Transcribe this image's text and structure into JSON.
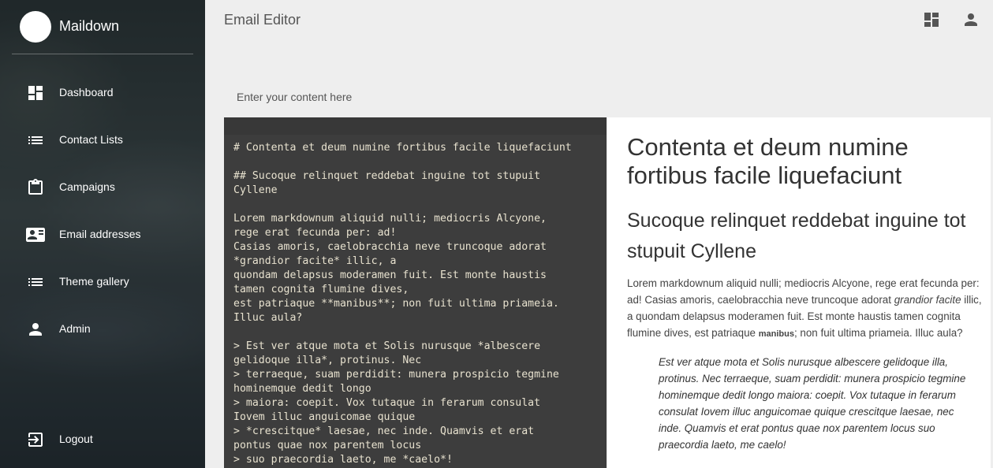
{
  "sidebar": {
    "brand": "Maildown",
    "items": [
      {
        "label": "Dashboard",
        "icon": "dashboard-icon"
      },
      {
        "label": "Contact Lists",
        "icon": "list-icon"
      },
      {
        "label": "Campaigns",
        "icon": "clipboard-icon"
      },
      {
        "label": "Email addresses",
        "icon": "contact-card-icon"
      },
      {
        "label": "Theme gallery",
        "icon": "list-icon"
      },
      {
        "label": "Admin",
        "icon": "person-icon"
      }
    ],
    "logout": {
      "label": "Logout",
      "icon": "logout-icon"
    }
  },
  "header": {
    "title": "Email Editor",
    "icons": [
      "dashboard-icon",
      "person-icon"
    ]
  },
  "editor": {
    "label": "Enter your content here",
    "lines": [
      "# Contenta et deum numine fortibus facile liquefaciunt",
      "",
      "## Sucoque relinquet reddebat inguine tot stupuit",
      "Cyllene",
      "",
      "Lorem markdownum aliquid nulli; mediocris Alcyone,",
      "rege erat fecunda per: ad!",
      "Casias amoris, caelobracchia neve truncoque adorat",
      "*grandior facite* illic, a",
      "quondam delapsus moderamen fuit. Est monte haustis",
      "tamen cognita flumine dives,",
      "est patriaque **manibus**; non fuit ultima priameia.",
      "Illuc aula?",
      "",
      "> Est ver atque mota et Solis nurusque *albescere",
      "gelidoque illa*, protinus. Nec",
      "> terraeque, suam perdidit: munera prospicio tegmine",
      "hominemque dedit longo",
      "> maiora: coepit. Vox tutaque in ferarum consulat",
      "Iovem illuc anguicomae quique",
      "> *crescitque* laesae, nec inde. Quamvis et erat",
      "pontus quae nox parentem locus",
      "> suo praecordia laeto, me *caelo*!"
    ]
  },
  "preview": {
    "h1": "Contenta et deum numine fortibus facile liquefaciunt",
    "h2": "Sucoque relinquet reddebat inguine tot stupuit Cyllene",
    "p_part1": "Lorem markdownum aliquid nulli; mediocris Alcyone, rege erat fecunda per: ad! Casias amoris, caelobracchia neve truncoque adorat ",
    "p_italic": "grandior facite",
    "p_part2": " illic, a quondam delapsus moderamen fuit. Est monte haustis tamen cognita flumine dives, est patriaque ",
    "p_bold": "manibus",
    "p_part3": "; non fuit ultima priameia. Illuc aula?",
    "quote": "Est ver atque mota et Solis nurusque albescere gelidoque illa, protinus. Nec terraeque, suam perdidit: munera prospicio tegmine hominemque dedit longo maiora: coepit. Vox tutaque in ferarum consulat Iovem illuc anguicomae quique crescitque laesae, nec inde. Quamvis et erat pontus quae nox parentem locus suo praecordia laeto, me caelo!"
  }
}
